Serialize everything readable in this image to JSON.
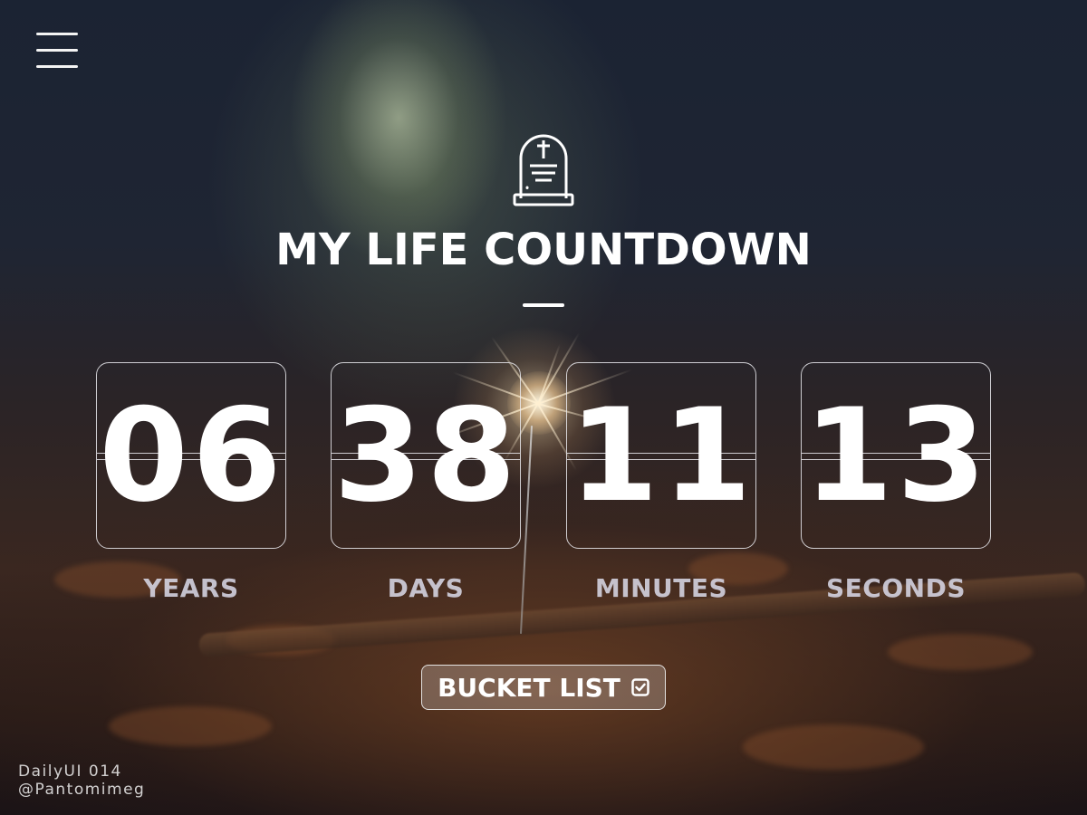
{
  "menu": {
    "icon": "hamburger-menu-icon"
  },
  "header": {
    "icon": "tombstone-icon",
    "title": "MY LIFE COUNTDOWN"
  },
  "countdown": [
    {
      "value": "06",
      "label": "YEARS"
    },
    {
      "value": "38",
      "label": "DAYS"
    },
    {
      "value": "11",
      "label": "MINUTES"
    },
    {
      "value": "13",
      "label": "SECONDS"
    }
  ],
  "bucket_button": {
    "label": "BUCKET LIST",
    "icon": "checkbox-checked-icon"
  },
  "credits": {
    "line1": "DailyUI 014",
    "line2": "@Pantomimeg"
  }
}
